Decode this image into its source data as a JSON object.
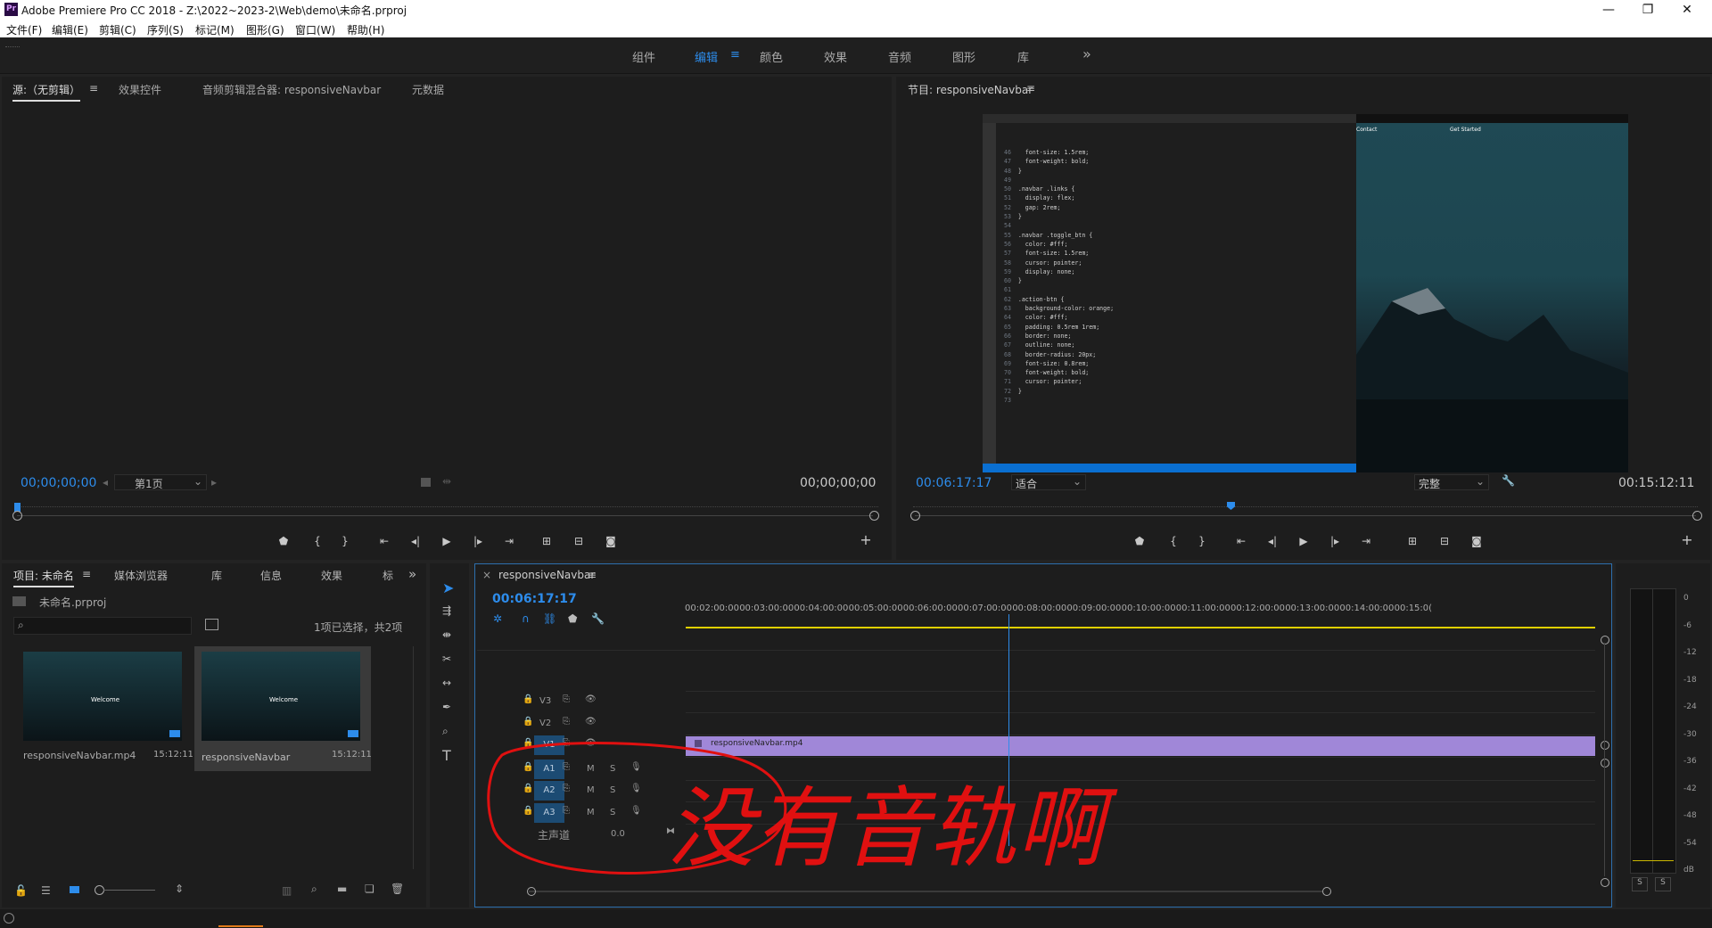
{
  "app": {
    "logo_text": "Pr",
    "title": "Adobe Premiere Pro CC 2018 - Z:\\2022~2023-2\\Web\\demo\\未命名.prproj",
    "minimize": "—",
    "maximize": "❐",
    "close": "✕"
  },
  "menu": [
    "文件(F)",
    "编辑(E)",
    "剪辑(C)",
    "序列(S)",
    "标记(M)",
    "图形(G)",
    "窗口(W)",
    "帮助(H)"
  ],
  "workspaces": [
    "组件",
    "编辑",
    "颜色",
    "效果",
    "音频",
    "图形",
    "库"
  ],
  "workspace_menu_icon": "≡",
  "workspace_more": "»",
  "source": {
    "tabs": [
      "源:（无剪辑）",
      "效果控件",
      "音频剪辑混合器: responsiveNavbar",
      "元数据"
    ],
    "tab_menu": "≡",
    "timecode_left": "00;00;00;00",
    "page": "第1页",
    "timecode_right": "00;00;00;00"
  },
  "program": {
    "tab": "节目: responsiveNavbar",
    "tab_menu": "≡",
    "timecode_left": "00:06:17:17",
    "fit": "适合",
    "quality": "完整",
    "timecode_right": "00:15:12:11"
  },
  "project": {
    "tabs": [
      "项目: 未命名",
      "媒体浏览器",
      "库",
      "信息",
      "效果",
      "标"
    ],
    "more": "»",
    "file": "未命名.prproj",
    "status": "1项已选择，共2项",
    "items": [
      {
        "name": "responsiveNavbar.mp4",
        "duration": "15:12:11"
      },
      {
        "name": "responsiveNavbar",
        "duration": "15:12:11"
      }
    ]
  },
  "timeline": {
    "tab": "responsiveNavbar",
    "close": "×",
    "menu": "≡",
    "timecode": "00:06:17:17",
    "ruler": [
      "00:02:00:00",
      "00:03:00:00",
      "00:04:00:00",
      "00:05:00:00",
      "00:06:00:00",
      "00:07:00:00",
      "00:08:00:00",
      "00:09:00:00",
      "00:10:00:00",
      "00:11:00:00",
      "00:12:00:00",
      "00:13:00:00",
      "00:14:00:00",
      "00:15:0("
    ],
    "video_tracks": [
      "V3",
      "V2",
      "V1"
    ],
    "audio_tracks": [
      "A1",
      "A2",
      "A3"
    ],
    "mute_label": "M",
    "solo_label": "S",
    "master_label": "主声道",
    "master_value": "0.0",
    "clip_name": "responsiveNavbar.mp4",
    "playhead_fraction": 0.355
  },
  "annotation_text": "没有音轨啊",
  "meter": {
    "scale": [
      "0",
      "-6",
      "-12",
      "-18",
      "-24",
      "-30",
      "-36",
      "-42",
      "-48",
      "-54",
      "dB"
    ],
    "solo_buttons": [
      "S",
      "S"
    ]
  },
  "code_preview": {
    "lines": [
      {
        "n": "46",
        "t": "  font-size: 1.5rem;"
      },
      {
        "n": "47",
        "t": "  font-weight: bold;"
      },
      {
        "n": "48",
        "t": "}"
      },
      {
        "n": "49",
        "t": ""
      },
      {
        "n": "50",
        "t": ".navbar .links {"
      },
      {
        "n": "51",
        "t": "  display: flex;"
      },
      {
        "n": "52",
        "t": "  gap: 2rem;"
      },
      {
        "n": "53",
        "t": "}"
      },
      {
        "n": "54",
        "t": ""
      },
      {
        "n": "55",
        "t": ".navbar .toggle_btn {"
      },
      {
        "n": "56",
        "t": "  color: #fff;"
      },
      {
        "n": "57",
        "t": "  font-size: 1.5rem;"
      },
      {
        "n": "58",
        "t": "  cursor: pointer;"
      },
      {
        "n": "59",
        "t": "  display: none;"
      },
      {
        "n": "60",
        "t": "}"
      },
      {
        "n": "61",
        "t": ""
      },
      {
        "n": "62",
        "t": ".action-btn {"
      },
      {
        "n": "63",
        "t": "  background-color: orange;"
      },
      {
        "n": "64",
        "t": "  color: #fff;"
      },
      {
        "n": "65",
        "t": "  padding: 0.5rem 1rem;"
      },
      {
        "n": "66",
        "t": "  border: none;"
      },
      {
        "n": "67",
        "t": "  outline: none;"
      },
      {
        "n": "68",
        "t": "  border-radius: 20px;"
      },
      {
        "n": "69",
        "t": "  font-size: 0.8rem;"
      },
      {
        "n": "70",
        "t": "  font-weight: bold;"
      },
      {
        "n": "71",
        "t": "  cursor: pointer;"
      },
      {
        "n": "72",
        "t": "}"
      },
      {
        "n": "73",
        "t": ""
      }
    ],
    "preview_links": [
      "Contact",
      "Get Started"
    ],
    "thumb_text": "Welcome"
  },
  "colors": {
    "accent": "#2d8ceb",
    "clip": "#a087d8",
    "annotation": "#e01010",
    "track_badge": "#1c4b73"
  }
}
